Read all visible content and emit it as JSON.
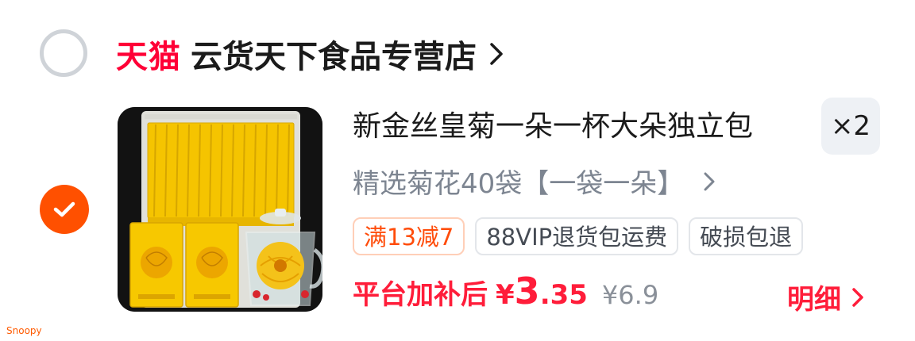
{
  "shop": {
    "brand_label": "天猫",
    "name": "云货天下食品专营店"
  },
  "product": {
    "title": "新金丝皇菊一朵一杯大朵独立包",
    "spec": "精选菊花40袋【一袋一朵】",
    "quantity": "×2",
    "tags": [
      {
        "label": "满13减7",
        "kind": "promo"
      },
      {
        "label": "88VIP退货包运费",
        "kind": "service"
      },
      {
        "label": "破损包退",
        "kind": "service"
      }
    ],
    "price": {
      "label": "平台加补后",
      "symbol": "¥",
      "integer": "3",
      "decimal": ".35",
      "original": "¥6.9"
    },
    "detail_label": "明细",
    "selected": true
  },
  "watermark": "Snoopy",
  "colors": {
    "tmall_red": "#ff0036",
    "price_red": "#ff1d3a",
    "check_orange": "#ff5000",
    "promo_tag_text": "#ff4c0a"
  },
  "icons": {
    "shop_radio": "unchecked-circle-icon",
    "item_check": "checkmark-icon",
    "chevron": "chevron-right-icon"
  }
}
